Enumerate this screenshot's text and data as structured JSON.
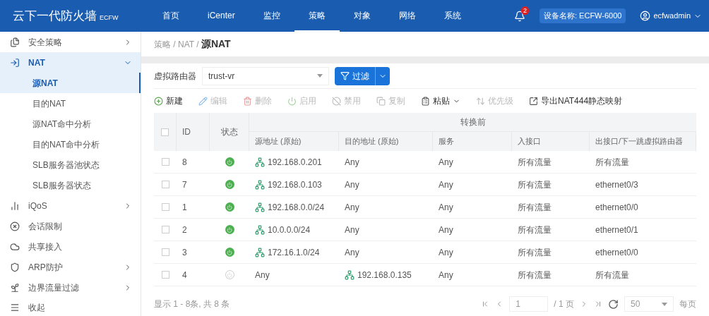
{
  "header": {
    "logo": "云下一代防火墙",
    "logo_suffix": "ECFW",
    "nav": [
      {
        "label": "首页",
        "selected": false
      },
      {
        "label": "iCenter",
        "selected": false
      },
      {
        "label": "监控",
        "selected": false
      },
      {
        "label": "策略",
        "selected": true
      },
      {
        "label": "对象",
        "selected": false
      },
      {
        "label": "网络",
        "selected": false
      },
      {
        "label": "系统",
        "selected": false
      }
    ],
    "notification_count": "2",
    "device_name": "设备名称: ECFW-6000",
    "user": "ecfwadmin"
  },
  "sidebar": {
    "items": [
      {
        "label": "安全策略",
        "has_arrow": true,
        "expanded": false
      },
      {
        "label": "NAT",
        "has_arrow": true,
        "expanded": true,
        "children": [
          {
            "label": "源NAT",
            "selected": true
          },
          {
            "label": "目的NAT",
            "selected": false
          },
          {
            "label": "源NAT命中分析",
            "selected": false
          },
          {
            "label": "目的NAT命中分析",
            "selected": false
          },
          {
            "label": "SLB服务器池状态",
            "selected": false
          },
          {
            "label": "SLB服务器状态",
            "selected": false
          }
        ]
      },
      {
        "label": "iQoS",
        "has_arrow": true,
        "expanded": false
      },
      {
        "label": "会话限制",
        "has_arrow": false,
        "expanded": false
      },
      {
        "label": "共享接入",
        "has_arrow": false,
        "expanded": false
      },
      {
        "label": "ARP防护",
        "has_arrow": true,
        "expanded": false
      },
      {
        "label": "边界流量过滤",
        "has_arrow": true,
        "expanded": false
      }
    ],
    "collapse": "收起"
  },
  "breadcrumb": {
    "path": "策略 / NAT / ",
    "current": "源NAT"
  },
  "filter": {
    "label": "虚拟路由器",
    "value": "trust-vr",
    "button": "过滤"
  },
  "toolbar": [
    {
      "label": "新建",
      "disabled": false,
      "dropdown": false
    },
    {
      "label": "编辑",
      "disabled": true,
      "dropdown": false
    },
    {
      "label": "删除",
      "disabled": true,
      "dropdown": false
    },
    {
      "label": "启用",
      "disabled": true,
      "dropdown": false
    },
    {
      "label": "禁用",
      "disabled": true,
      "dropdown": false
    },
    {
      "label": "复制",
      "disabled": true,
      "dropdown": false
    },
    {
      "label": "粘贴",
      "disabled": false,
      "dropdown": true
    },
    {
      "label": "优先级",
      "disabled": true,
      "dropdown": false
    },
    {
      "label": "导出NAT444静态映射",
      "disabled": false,
      "dropdown": false
    }
  ],
  "table": {
    "all_checked": false,
    "group_header": "转换前",
    "columns": [
      "ID",
      "状态",
      "源地址 (原始)",
      "目的地址 (原始)",
      "服务",
      "入接口",
      "出接口/下一跳虚拟路由器"
    ],
    "rows": [
      {
        "checked": false,
        "id": "8",
        "enabled": true,
        "source": {
          "text": "192.168.0.201",
          "kind": "address"
        },
        "destination": {
          "text": "Any",
          "kind": "any"
        },
        "service": "Any",
        "ingress": "所有流量",
        "egress": "所有流量"
      },
      {
        "checked": false,
        "id": "7",
        "enabled": true,
        "source": {
          "text": "192.168.0.103",
          "kind": "address"
        },
        "destination": {
          "text": "Any",
          "kind": "any"
        },
        "service": "Any",
        "ingress": "所有流量",
        "egress": "ethernet0/3"
      },
      {
        "checked": false,
        "id": "1",
        "enabled": true,
        "source": {
          "text": "192.168.0.0/24",
          "kind": "address"
        },
        "destination": {
          "text": "Any",
          "kind": "any"
        },
        "service": "Any",
        "ingress": "所有流量",
        "egress": "ethernet0/0"
      },
      {
        "checked": false,
        "id": "2",
        "enabled": true,
        "source": {
          "text": "10.0.0.0/24",
          "kind": "address"
        },
        "destination": {
          "text": "Any",
          "kind": "any"
        },
        "service": "Any",
        "ingress": "所有流量",
        "egress": "ethernet0/1"
      },
      {
        "checked": false,
        "id": "3",
        "enabled": true,
        "source": {
          "text": "172.16.1.0/24",
          "kind": "address"
        },
        "destination": {
          "text": "Any",
          "kind": "any"
        },
        "service": "Any",
        "ingress": "所有流量",
        "egress": "ethernet0/0"
      },
      {
        "checked": false,
        "id": "4",
        "enabled": false,
        "source": {
          "text": "Any",
          "kind": "any"
        },
        "destination": {
          "text": "192.168.0.135",
          "kind": "address"
        },
        "service": "Any",
        "ingress": "所有流量",
        "egress": "所有流量"
      }
    ]
  },
  "pagination": {
    "summary": "显示 1 - 8条, 共 8 条",
    "page": "1",
    "total_pages": "/ 1 页",
    "page_size": "50",
    "per_page": "每页"
  }
}
